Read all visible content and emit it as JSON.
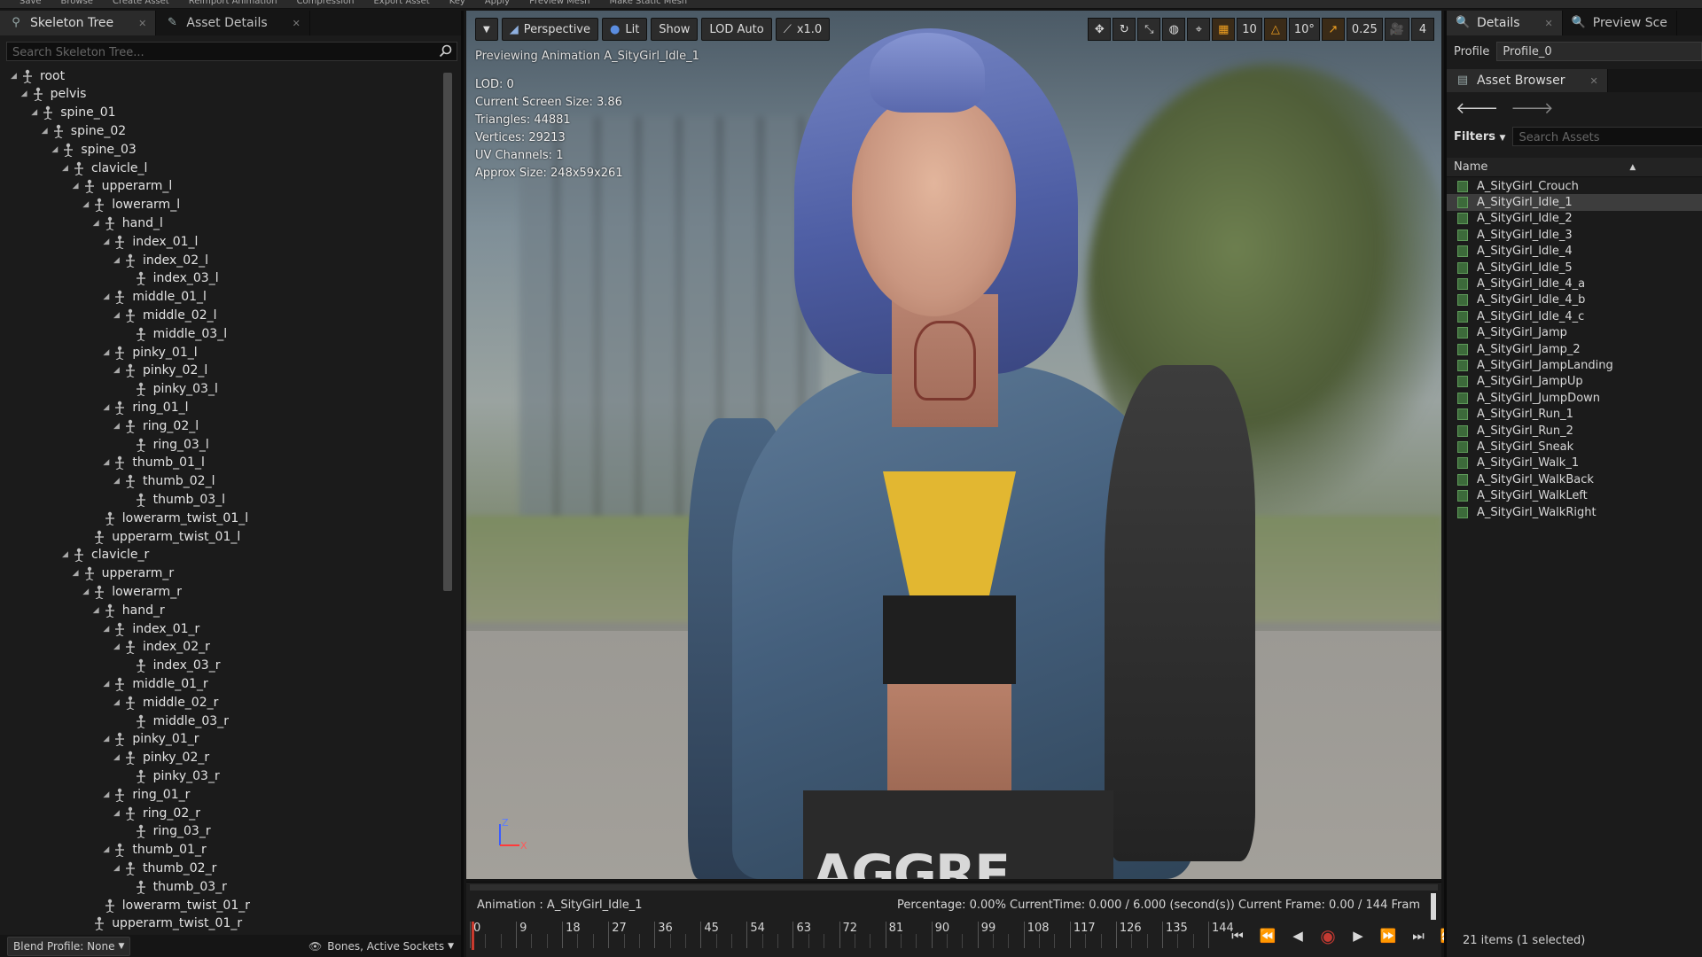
{
  "menu": [
    "Save",
    "Browse",
    "Create Asset",
    "Reimport Animation",
    "Compression",
    "Export Asset",
    "Key",
    "Apply",
    "Preview Mesh",
    "Make Static Mesh"
  ],
  "left_panel": {
    "tabs": [
      {
        "label": "Skeleton Tree",
        "icon": "skeleton-icon"
      },
      {
        "label": "Asset Details",
        "icon": "details-icon"
      }
    ],
    "search_placeholder": "Search Skeleton Tree...",
    "bones": [
      {
        "name": "root",
        "depth": 0,
        "expander": true
      },
      {
        "name": "pelvis",
        "depth": 1,
        "expander": true
      },
      {
        "name": "spine_01",
        "depth": 2,
        "expander": true
      },
      {
        "name": "spine_02",
        "depth": 3,
        "expander": true
      },
      {
        "name": "spine_03",
        "depth": 4,
        "expander": true
      },
      {
        "name": "clavicle_l",
        "depth": 5,
        "expander": true
      },
      {
        "name": "upperarm_l",
        "depth": 6,
        "expander": true
      },
      {
        "name": "lowerarm_l",
        "depth": 7,
        "expander": true
      },
      {
        "name": "hand_l",
        "depth": 8,
        "expander": true
      },
      {
        "name": "index_01_l",
        "depth": 9,
        "expander": true
      },
      {
        "name": "index_02_l",
        "depth": 10,
        "expander": true
      },
      {
        "name": "index_03_l",
        "depth": 11,
        "expander": false
      },
      {
        "name": "middle_01_l",
        "depth": 9,
        "expander": true
      },
      {
        "name": "middle_02_l",
        "depth": 10,
        "expander": true
      },
      {
        "name": "middle_03_l",
        "depth": 11,
        "expander": false
      },
      {
        "name": "pinky_01_l",
        "depth": 9,
        "expander": true
      },
      {
        "name": "pinky_02_l",
        "depth": 10,
        "expander": true
      },
      {
        "name": "pinky_03_l",
        "depth": 11,
        "expander": false
      },
      {
        "name": "ring_01_l",
        "depth": 9,
        "expander": true
      },
      {
        "name": "ring_02_l",
        "depth": 10,
        "expander": true
      },
      {
        "name": "ring_03_l",
        "depth": 11,
        "expander": false
      },
      {
        "name": "thumb_01_l",
        "depth": 9,
        "expander": true
      },
      {
        "name": "thumb_02_l",
        "depth": 10,
        "expander": true
      },
      {
        "name": "thumb_03_l",
        "depth": 11,
        "expander": false
      },
      {
        "name": "lowerarm_twist_01_l",
        "depth": 8,
        "expander": false
      },
      {
        "name": "upperarm_twist_01_l",
        "depth": 7,
        "expander": false
      },
      {
        "name": "clavicle_r",
        "depth": 5,
        "expander": true
      },
      {
        "name": "upperarm_r",
        "depth": 6,
        "expander": true
      },
      {
        "name": "lowerarm_r",
        "depth": 7,
        "expander": true
      },
      {
        "name": "hand_r",
        "depth": 8,
        "expander": true
      },
      {
        "name": "index_01_r",
        "depth": 9,
        "expander": true
      },
      {
        "name": "index_02_r",
        "depth": 10,
        "expander": true
      },
      {
        "name": "index_03_r",
        "depth": 11,
        "expander": false
      },
      {
        "name": "middle_01_r",
        "depth": 9,
        "expander": true
      },
      {
        "name": "middle_02_r",
        "depth": 10,
        "expander": true
      },
      {
        "name": "middle_03_r",
        "depth": 11,
        "expander": false
      },
      {
        "name": "pinky_01_r",
        "depth": 9,
        "expander": true
      },
      {
        "name": "pinky_02_r",
        "depth": 10,
        "expander": true
      },
      {
        "name": "pinky_03_r",
        "depth": 11,
        "expander": false
      },
      {
        "name": "ring_01_r",
        "depth": 9,
        "expander": true
      },
      {
        "name": "ring_02_r",
        "depth": 10,
        "expander": true
      },
      {
        "name": "ring_03_r",
        "depth": 11,
        "expander": false
      },
      {
        "name": "thumb_01_r",
        "depth": 9,
        "expander": true
      },
      {
        "name": "thumb_02_r",
        "depth": 10,
        "expander": true
      },
      {
        "name": "thumb_03_r",
        "depth": 11,
        "expander": false
      },
      {
        "name": "lowerarm_twist_01_r",
        "depth": 8,
        "expander": false
      },
      {
        "name": "upperarm_twist_01_r",
        "depth": 7,
        "expander": false
      }
    ],
    "footer": {
      "blend_profile": "Blend Profile: None",
      "bones_filter": "Bones, Active Sockets"
    }
  },
  "viewport": {
    "toolbar": {
      "perspective": "Perspective",
      "lit": "Lit",
      "show": "Show",
      "lod": "LOD Auto",
      "speed": "x1.0"
    },
    "right_toolbar": {
      "grid_snap": "10",
      "angle_snap": "10°",
      "scale_snap": "0.25",
      "camera_speed": "4"
    },
    "previewing": "Previewing Animation A_SityGirl_Idle_1",
    "stats": [
      "LOD: 0",
      "Current Screen Size: 3.86",
      "Triangles: 44881",
      "Vertices: 29213",
      "UV Channels: 1",
      "Approx Size: 248x59x261"
    ],
    "shirt_text": "AGGRE",
    "axis": {
      "z": "Z",
      "x": "X"
    }
  },
  "timeline": {
    "animation": "Animation :  A_SityGirl_Idle_1",
    "status": "Percentage:  0.00% CurrentTime:  0.000 / 6.000 (second(s)) Current Frame:  0.00 / 144 Fram",
    "ticks": [
      "0",
      "9",
      "18",
      "27",
      "36",
      "45",
      "54",
      "63",
      "72",
      "81",
      "90",
      "99",
      "108",
      "117",
      "126",
      "135",
      "144"
    ],
    "progress": 0.0
  },
  "right_panel": {
    "tabs": [
      {
        "label": "Details",
        "icon": "details-icon"
      },
      {
        "label": "Preview Sce",
        "icon": "preview-icon"
      }
    ],
    "profile_label": "Profile",
    "profile_value": "Profile_0",
    "asset_tab": "Asset Browser",
    "filters_label": "Filters",
    "search_placeholder": "Search Assets",
    "column": "Name",
    "assets": [
      "A_SityGirl_Crouch",
      "A_SityGirl_Idle_1",
      "A_SityGirl_Idle_2",
      "A_SityGirl_Idle_3",
      "A_SityGirl_Idle_4",
      "A_SityGirl_Idle_5",
      "A_SityGirl_Idle_4_a",
      "A_SityGirl_Idle_4_b",
      "A_SityGirl_Idle_4_c",
      "A_SityGirl_Jamp",
      "A_SityGirl_Jamp_2",
      "A_SityGirl_JampLanding",
      "A_SityGirl_JampUp",
      "A_SityGirl_JumpDown",
      "A_SityGirl_Run_1",
      "A_SityGirl_Run_2",
      "A_SityGirl_Sneak",
      "A_SityGirl_Walk_1",
      "A_SityGirl_WalkBack",
      "A_SityGirl_WalkLeft",
      "A_SityGirl_WalkRight"
    ],
    "selected_index": 1,
    "footer": "21 items (1 selected)"
  },
  "colors": {
    "accent_record": "#c43a32",
    "orange_toolbar": "#f0a020",
    "panel_bg": "#1b1b1b",
    "selected_row": "#3d3d3d"
  }
}
